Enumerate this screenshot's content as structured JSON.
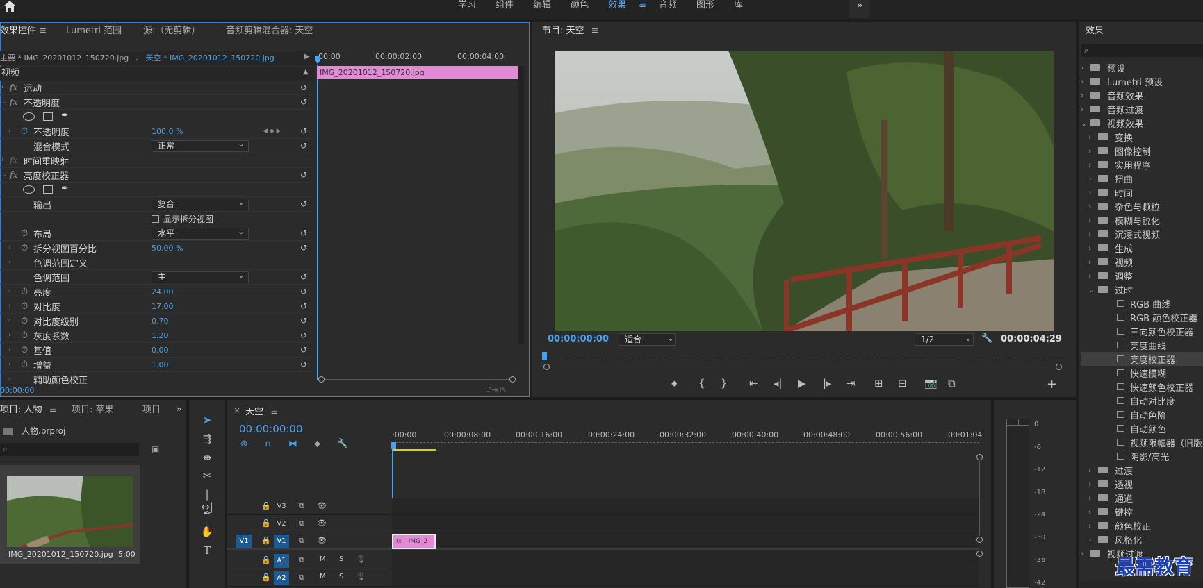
{
  "workspaces": [
    "学习",
    "组件",
    "编辑",
    "颜色",
    "效果",
    "音频",
    "图形",
    "库"
  ],
  "active_workspace": "效果",
  "more_icon": "»",
  "effect_controls": {
    "tabs": [
      "效果控件",
      "Lumetri 范围",
      "源:（无剪辑）",
      "音频剪辑混合器: 天空"
    ],
    "master": "主要 * IMG_20201012_150720.jpg",
    "seq": "天空 * IMG_20201012_150720.jpg",
    "ruler": [
      "00:00",
      "00:00:02:00",
      "00:00:04:00"
    ],
    "clip": "IMG_20201012_150720.jpg",
    "section": "视频",
    "time": "00:00:00",
    "rows": {
      "motion": "运动",
      "opacity": "不透明度",
      "opacity_prop": "不透明度",
      "opacity_val": "100.0 %",
      "blend": "混合模式",
      "blend_val": "正常",
      "time_remap": "时间重映射",
      "brightness_corrector": "亮度校正器",
      "output": "输出",
      "output_val": "复合",
      "split_view": "显示拆分视图",
      "layout": "布局",
      "layout_val": "水平",
      "split_pct": "拆分视图百分比",
      "split_pct_val": "50.00 %",
      "tonal_def": "色调范围定义",
      "tonal_range": "色调范围",
      "tonal_range_val": "主",
      "brightness": "亮度",
      "brightness_val": "24.00",
      "contrast": "对比度",
      "contrast_val": "17.00",
      "contrast_level": "对比度级别",
      "contrast_level_val": "0.70",
      "gamma": "灰度系数",
      "gamma_val": "1.20",
      "pedestal": "基值",
      "pedestal_val": "0.00",
      "gain": "增益",
      "gain_val": "1.00",
      "aux": "辅助颜色校正"
    }
  },
  "program": {
    "title": "节目: 天空",
    "time": "00:00:00:00",
    "fit": "适合",
    "res": "1/2",
    "duration": "00:00:04:29"
  },
  "effects_panel": {
    "title": "效果",
    "items": [
      "预设",
      "Lumetri 预设",
      "音频效果",
      "音频过渡",
      "视频效果",
      "变换",
      "图像控制",
      "实用程序",
      "扭曲",
      "时间",
      "杂色与颗粒",
      "模糊与锐化",
      "沉浸式视频",
      "生成",
      "视频",
      "调整",
      "过时",
      "RGB 曲线",
      "RGB 颜色校正器",
      "三向颜色校正器",
      "亮度曲线",
      "亮度校正器",
      "快速模糊",
      "快速颜色校正器",
      "自动对比度",
      "自动色阶",
      "自动颜色",
      "视频限幅器（旧版）",
      "阴影/高光",
      "过渡",
      "透视",
      "通道",
      "键控",
      "颜色校正",
      "风格化",
      "视频过渡"
    ]
  },
  "project": {
    "tabs": [
      "项目: 人物",
      "项目: 苹果",
      "项目"
    ],
    "file": "人物.prproj",
    "clip_name": "IMG_20201012_150720.jpg",
    "clip_dur": "5:00"
  },
  "timeline": {
    "tab": "天空",
    "time": "00:00:00:00",
    "ruler": [
      ":00:00",
      "00:00:08:00",
      "00:00:16:00",
      "00:00:24:00",
      "00:00:32:00",
      "00:00:40:00",
      "00:00:48:00",
      "00:00:56:00",
      "00:01:04"
    ],
    "tracks": [
      "V3",
      "V2",
      "V1",
      "A1",
      "A2"
    ],
    "src_v1": "V1",
    "m": "M",
    "s": "S",
    "clip": "IMG_2"
  },
  "meter": [
    "0",
    "-6",
    "-12",
    "-18",
    "-24",
    "-30",
    "-36",
    "-42"
  ],
  "watermark": "最需教育",
  "colors": {
    "accent": "#4aa2ec",
    "clip": "#e28ad6",
    "bg": "#2b2b2b"
  }
}
